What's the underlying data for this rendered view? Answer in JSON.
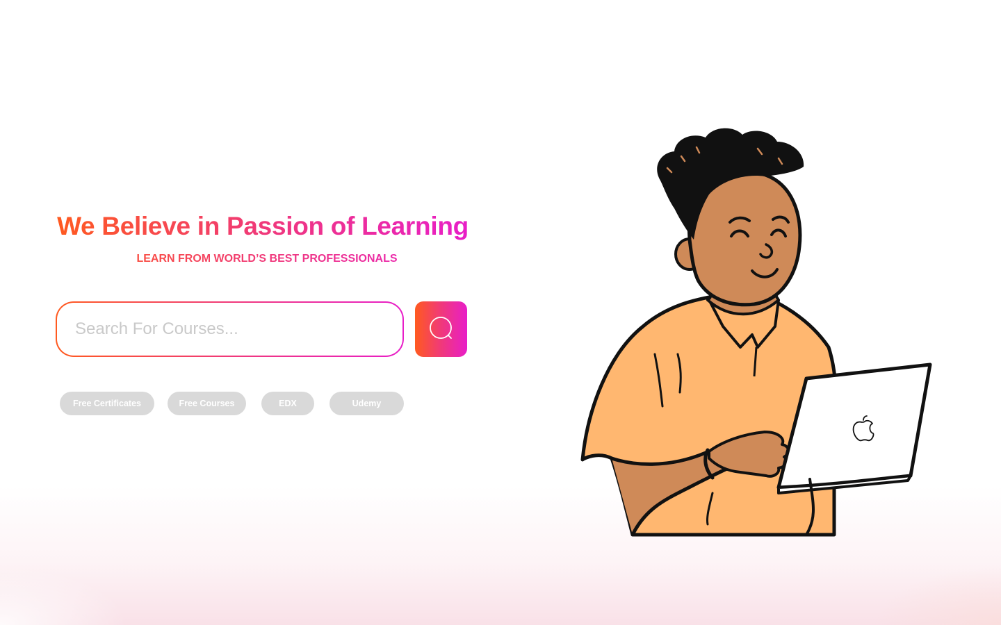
{
  "hero": {
    "title": "We Believe in Passion of Learning",
    "subtitle": "LEARN FROM WORLD’S BEST PROFESSIONALS"
  },
  "search": {
    "placeholder": "Search For Courses...",
    "button_icon": "search-icon"
  },
  "tags": [
    {
      "label": "Free Certificates"
    },
    {
      "label": "Free Courses"
    },
    {
      "label": "EDX"
    },
    {
      "label": "Udemy"
    }
  ],
  "illustration": {
    "subject": "person-with-laptop",
    "laptop_logo_icon": "apple-logo-icon"
  },
  "colors": {
    "gradient_start": "#ff5a1f",
    "gradient_mid": "#f0397a",
    "gradient_end": "#e81ec8",
    "tag_background": "#d9d9d9",
    "shirt": "#ffb770",
    "skin": "#cf8a58",
    "hair": "#111111"
  }
}
